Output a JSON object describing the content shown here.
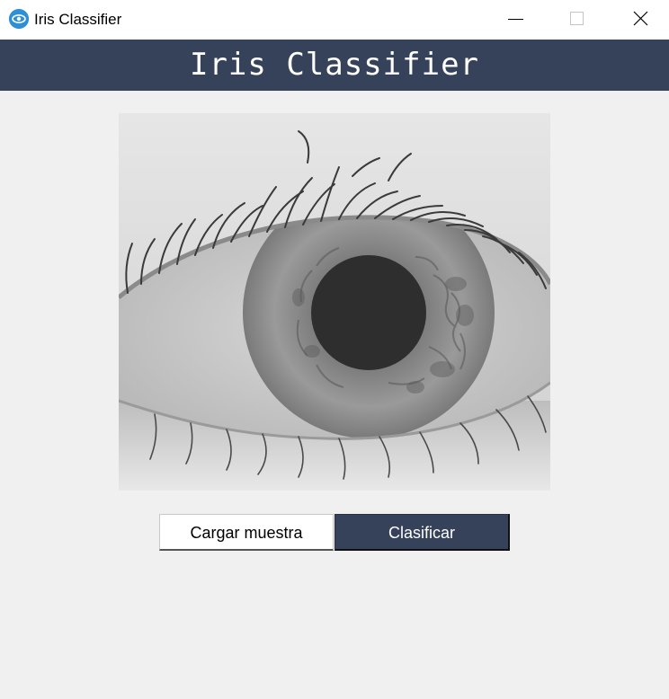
{
  "window": {
    "title": "Iris Classifier",
    "icon": "eye-app-icon",
    "controls": [
      "minimize-icon",
      "maximize-icon",
      "close-icon"
    ]
  },
  "header": {
    "title": "Iris Classifier",
    "background": "#354259"
  },
  "image": {
    "subject": "iris-eye-image"
  },
  "buttons": {
    "load_label": "Cargar muestra",
    "classify_label": "Clasificar"
  },
  "colors": {
    "accent": "#354259",
    "background": "#f0f0f0",
    "load_button_bg": "#ffffff"
  }
}
